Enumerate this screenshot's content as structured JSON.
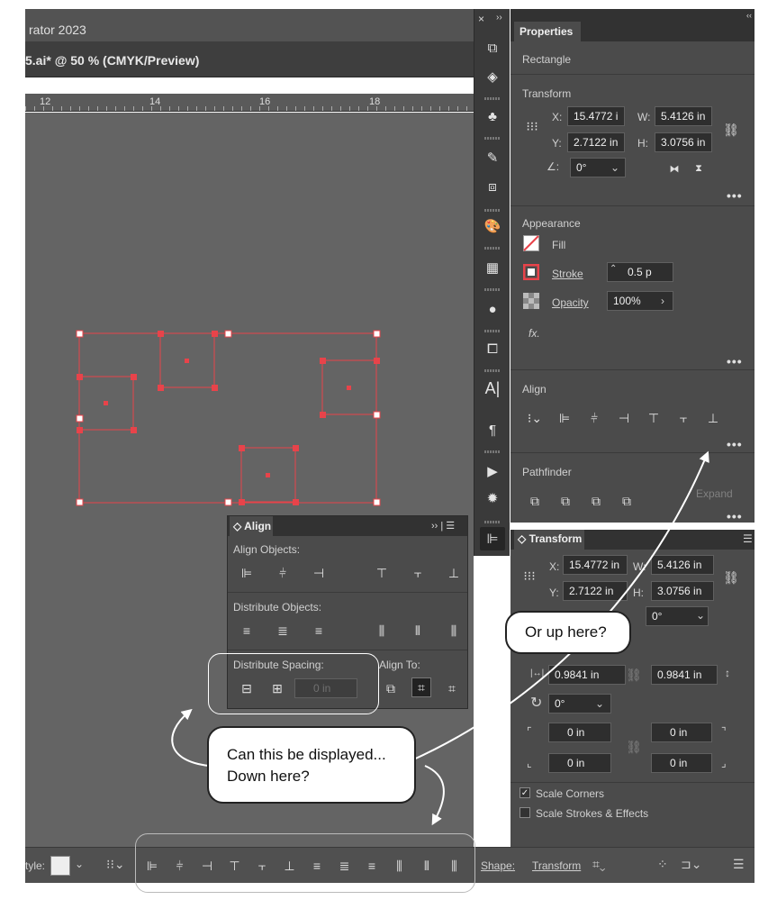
{
  "window": {
    "title": "rator 2023",
    "doc_tab": "5.ai* @ 50 % (CMYK/Preview)"
  },
  "ruler": {
    "marks": [
      "12",
      "14",
      "16",
      "18"
    ]
  },
  "strip_controls": {
    "close": "×",
    "expand": "››",
    "collapse": "‹‹"
  },
  "properties": {
    "tab": "Properties",
    "object_type": "Rectangle",
    "transform": {
      "title": "Transform",
      "x_label": "X:",
      "x": "15.4772 i",
      "y_label": "Y:",
      "y": "2.7122 in",
      "w_label": "W:",
      "w": "5.4126 in",
      "h_label": "H:",
      "h": "3.0756 in",
      "angle": "0°"
    },
    "appearance": {
      "title": "Appearance",
      "fill": "Fill",
      "stroke": "Stroke",
      "stroke_value": "0.5 p",
      "opacity": "Opacity",
      "opacity_value": "100%",
      "fx": "fx."
    },
    "align": {
      "title": "Align"
    },
    "pathfinder": {
      "title": "Pathfinder",
      "expand": "Expand"
    },
    "more": "•••"
  },
  "transform_panel": {
    "title": "Transform",
    "x_label": "X:",
    "x": "15.4772 in",
    "y_label": "Y:",
    "y": "2.7122 in",
    "w_label": "W:",
    "w": "5.4126 in",
    "h_label": "H:",
    "h": "3.0756 in",
    "shear": "0°",
    "width_gap": "0.9841 in",
    "height_gap": "0.9841 in",
    "rotate": "0°",
    "corner_tl": "0 in",
    "corner_tr": "0 in",
    "corner_bl": "0 in",
    "corner_br": "0 in",
    "scale_corners": "Scale Corners",
    "scale_strokes": "Scale Strokes & Effects"
  },
  "align_panel": {
    "title": "Align",
    "align_objects": "Align Objects:",
    "distribute_objects": "Distribute Objects:",
    "distribute_spacing": "Distribute Spacing:",
    "align_to": "Align To:",
    "spacing_value": "0 in",
    "panel_menu": "›› | ☰"
  },
  "control_bar": {
    "style_label": "tyle:",
    "shape": "Shape:",
    "transform": "Transform"
  },
  "callouts": {
    "up": "Or up here?",
    "down": "Can this be displayed...\nDown here?"
  },
  "colors": {
    "panel": "#4b4b4b",
    "dark": "#323232",
    "canvas": "#646464",
    "selection": "#e8434a"
  }
}
